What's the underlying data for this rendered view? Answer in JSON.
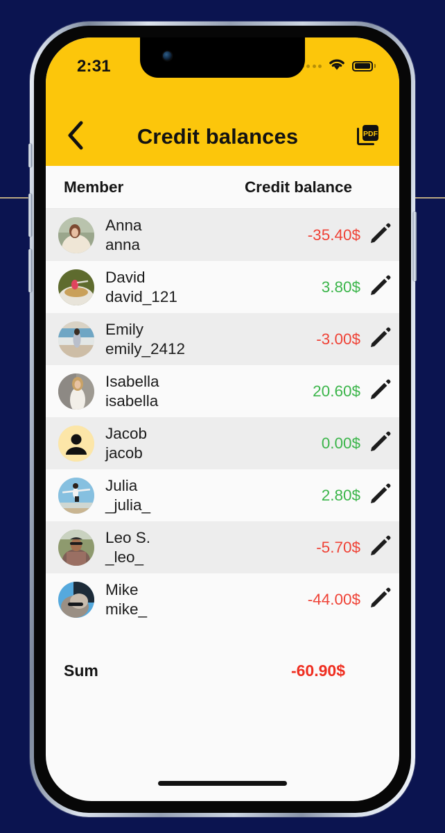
{
  "status_bar": {
    "time": "2:31",
    "cellular_icon": "signal-dots-icon",
    "wifi_icon": "wifi-icon",
    "battery_icon": "battery-full-icon"
  },
  "nav": {
    "back_icon": "chevron-left-icon",
    "title": "Credit balances",
    "pdf_icon": "pdf-export-icon",
    "pdf_label": "PDF"
  },
  "table": {
    "columns": [
      "Member",
      "Credit balance"
    ],
    "rows": [
      {
        "name": "Anna",
        "handle": "anna",
        "amount": "-35.40$",
        "sign": "neg",
        "avatar": "photo-anna",
        "edit_icon": "pencil-icon"
      },
      {
        "name": "David",
        "handle": "david_121",
        "amount": "3.80$",
        "sign": "pos",
        "avatar": "photo-david",
        "edit_icon": "pencil-icon"
      },
      {
        "name": "Emily",
        "handle": "emily_2412",
        "amount": "-3.00$",
        "sign": "neg",
        "avatar": "photo-emily",
        "edit_icon": "pencil-icon"
      },
      {
        "name": "Isabella",
        "handle": "isabella",
        "amount": "20.60$",
        "sign": "pos",
        "avatar": "photo-isabella",
        "edit_icon": "pencil-icon"
      },
      {
        "name": "Jacob",
        "handle": "jacob",
        "amount": "0.00$",
        "sign": "pos",
        "avatar": "placeholder-person-icon",
        "edit_icon": "pencil-icon"
      },
      {
        "name": "Julia",
        "handle": "_julia_",
        "amount": "2.80$",
        "sign": "pos",
        "avatar": "photo-julia",
        "edit_icon": "pencil-icon"
      },
      {
        "name": "Leo S.",
        "handle": "_leo_",
        "amount": "-5.70$",
        "sign": "neg",
        "avatar": "photo-leo",
        "edit_icon": "pencil-icon"
      },
      {
        "name": "Mike",
        "handle": "mike_",
        "amount": "-44.00$",
        "sign": "neg",
        "avatar": "photo-mike",
        "edit_icon": "pencil-icon"
      }
    ]
  },
  "summary": {
    "label": "Sum",
    "value": "-60.90$"
  },
  "colors": {
    "brand_yellow": "#fcc60b",
    "negative": "#ef4236",
    "positive": "#3bb54a",
    "sum_negative": "#ef2e20",
    "row_alt": "#ededed",
    "row_base": "#fafafa",
    "backdrop": "#0b1450"
  }
}
